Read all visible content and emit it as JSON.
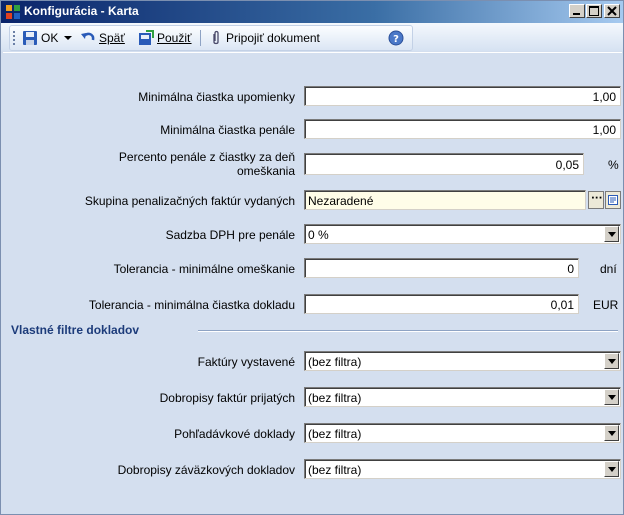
{
  "window": {
    "title": "Konfigurácia - Karta"
  },
  "toolbar": {
    "ok_label": "OK",
    "back_label": "Späť",
    "apply_label": "Použiť",
    "attach_label": "Pripojiť dokument"
  },
  "fields": {
    "min_reminder": {
      "label": "Minimálna čiastka upomienky",
      "value": "1,00"
    },
    "min_penalty": {
      "label": "Minimálna čiastka penále",
      "value": "1,00"
    },
    "penalty_percent": {
      "label_line1": "Percento penále z čiastky za deň",
      "label_line2": "omeškania",
      "value": "0,05",
      "unit": "%"
    },
    "penalty_group": {
      "label": "Skupina penalizačných faktúr vydaných",
      "value": "Nezaradené"
    },
    "vat_rate": {
      "label": "Sadzba DPH pre penále",
      "value": "0 %"
    },
    "tolerance_delay": {
      "label": "Tolerancia - minimálne omeškanie",
      "value": "0",
      "unit": "dní"
    },
    "tolerance_amount": {
      "label": "Tolerancia - minimálna čiastka dokladu",
      "value": "0,01",
      "unit": "EUR"
    }
  },
  "section_title": "Vlastné filtre dokladov",
  "filters": {
    "issued_invoices": {
      "label": "Faktúry vystavené",
      "value": "(bez filtra)"
    },
    "received_credit_notes": {
      "label": "Dobropisy faktúr prijatých",
      "value": "(bez filtra)"
    },
    "receivable_docs": {
      "label": "Pohľadávkové doklady",
      "value": "(bez filtra)"
    },
    "payable_credit_notes": {
      "label": "Dobropisy záväzkových dokladov",
      "value": "(bez filtra)"
    }
  }
}
